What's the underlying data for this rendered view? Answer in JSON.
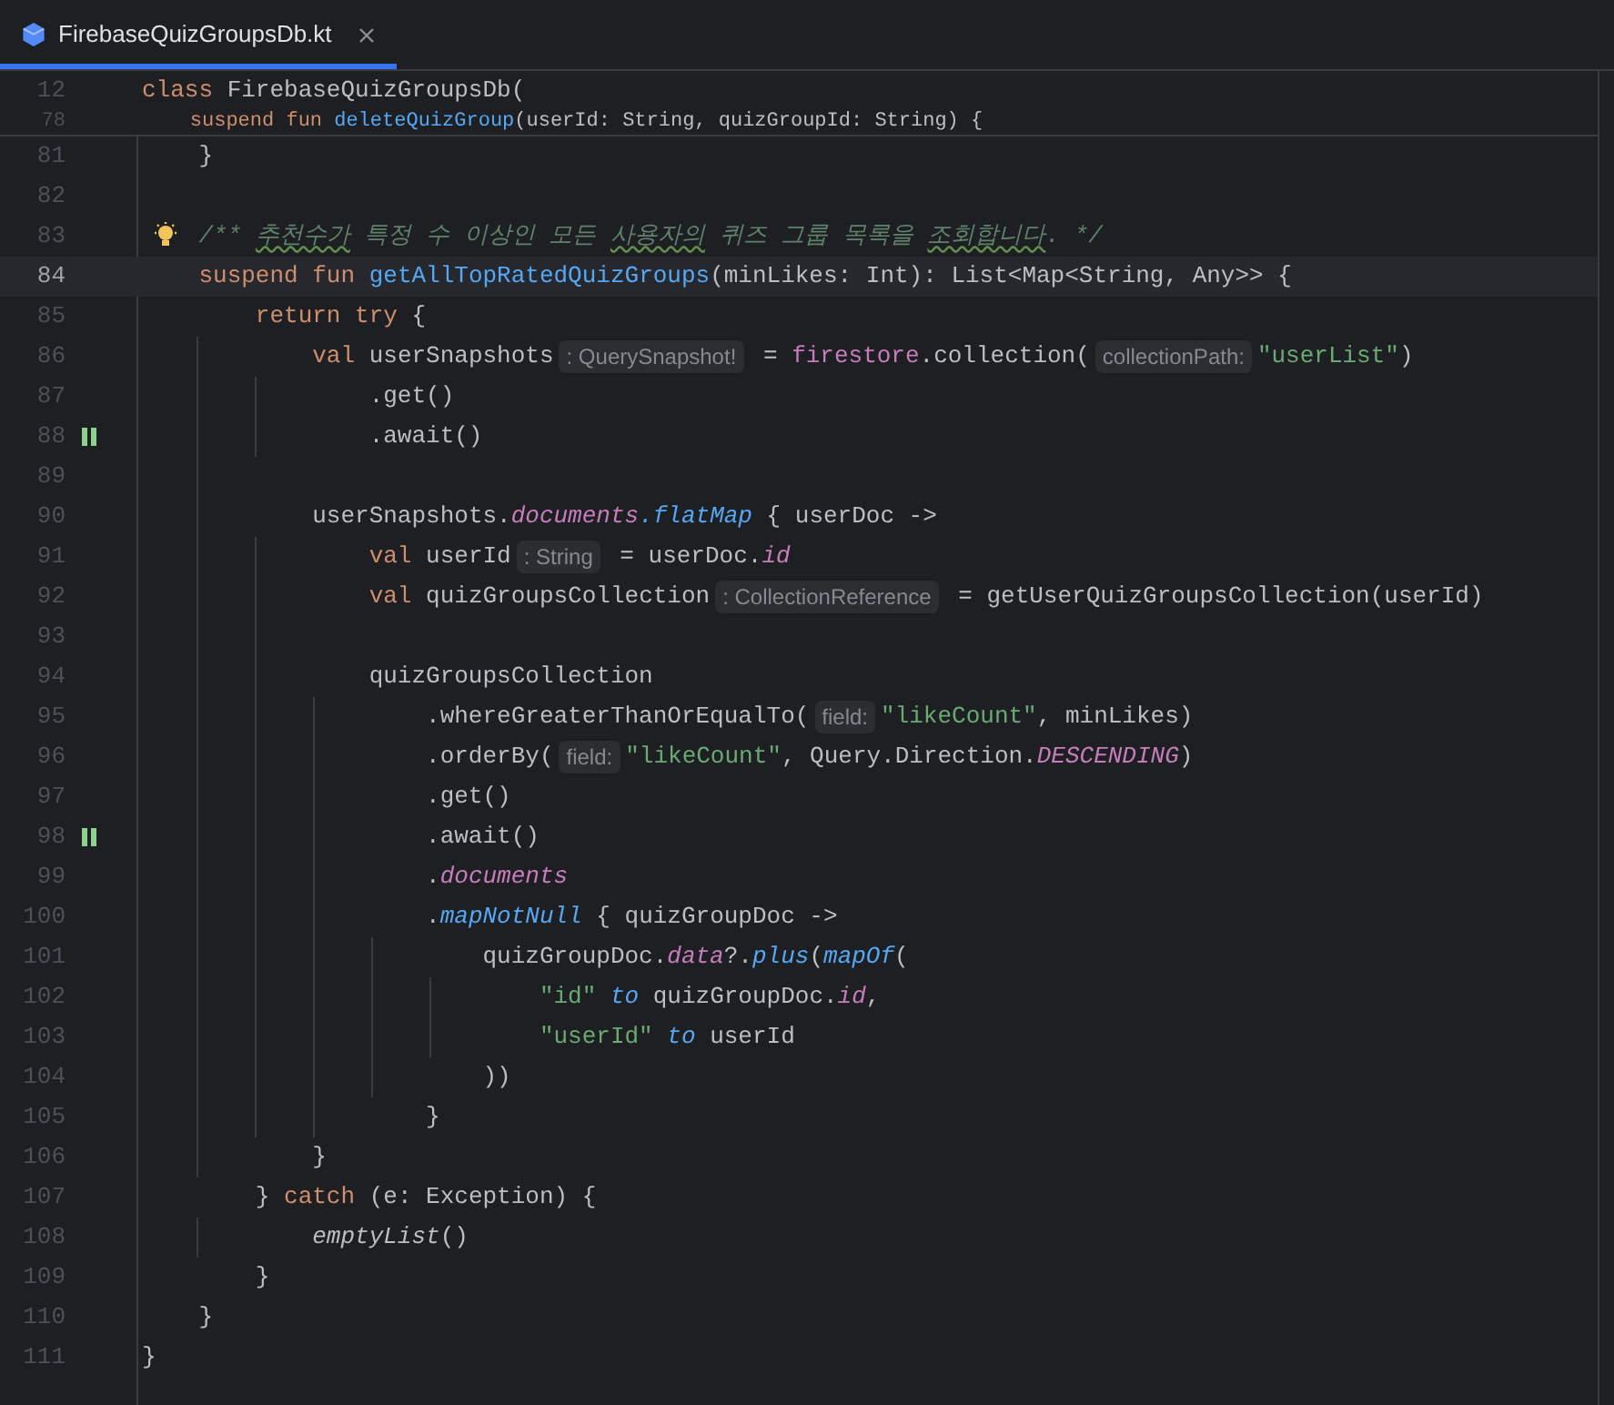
{
  "tab": {
    "title": "FirebaseQuizGroupsDb.kt",
    "selected": true
  },
  "sticky_lines": [
    {
      "number": "12",
      "tokens": [
        {
          "kind": "kw",
          "text": "class "
        },
        {
          "kind": "plain",
          "text": "FirebaseQuizGroupsDb("
        }
      ]
    },
    {
      "number": "78",
      "tokens": [
        {
          "kind": "kw",
          "text": "    suspend fun "
        },
        {
          "kind": "fn",
          "text": "deleteQuizGroup"
        },
        {
          "kind": "plain",
          "text": "(userId: String, quizGroupId: String) {"
        }
      ]
    }
  ],
  "lines": [
    {
      "number": "81",
      "current": false,
      "bulb": false,
      "suspend_call": false,
      "tokens": [
        {
          "kind": "plain",
          "text": "    }"
        }
      ]
    },
    {
      "number": "82",
      "current": false,
      "bulb": false,
      "suspend_call": false
    },
    {
      "number": "83",
      "current": false,
      "bulb": true,
      "suspend_call": false,
      "tokens": [
        {
          "kind": "doc",
          "text": "    /** "
        },
        {
          "kind": "typo",
          "text": "추천수가"
        },
        {
          "kind": "doc",
          "text": " 특정 수 이상인 모든 "
        },
        {
          "kind": "typo",
          "text": "사용자의"
        },
        {
          "kind": "doc",
          "text": " 퀴즈 그룹 목록을 "
        },
        {
          "kind": "typo",
          "text": "조회합니다"
        },
        {
          "kind": "doc",
          "text": ". */"
        }
      ]
    },
    {
      "number": "84",
      "current": true,
      "bulb": false,
      "suspend_call": false,
      "tokens": [
        {
          "kind": "kw",
          "text": "    suspend fun "
        },
        {
          "kind": "fn",
          "text": "getAllTopRatedQuizGroups"
        },
        {
          "kind": "plain",
          "text": "(minLikes: Int): List<Map<String, Any>> {"
        }
      ]
    },
    {
      "number": "85",
      "current": false,
      "bulb": false,
      "suspend_call": false,
      "tokens": [
        {
          "kind": "kw",
          "text": "        return try "
        },
        {
          "kind": "plain",
          "text": "{"
        }
      ]
    },
    {
      "number": "86",
      "current": false,
      "bulb": false,
      "suspend_call": false,
      "tokens": [
        {
          "kind": "kw",
          "text": "            val "
        },
        {
          "kind": "plain",
          "text": "userSnapshots"
        },
        {
          "kind": "hint",
          "text": ": QuerySnapshot!"
        },
        {
          "kind": "plain",
          "text": " = "
        },
        {
          "kind": "member",
          "text": "firestore"
        },
        {
          "kind": "plain",
          "text": ".collection("
        },
        {
          "kind": "hint",
          "text": "collectionPath:"
        },
        {
          "kind": "str",
          "text": "\"userList\""
        },
        {
          "kind": "plain",
          "text": ")"
        }
      ]
    },
    {
      "number": "87",
      "current": false,
      "bulb": false,
      "suspend_call": false,
      "tokens": [
        {
          "kind": "plain",
          "text": "                .get()"
        }
      ]
    },
    {
      "number": "88",
      "current": false,
      "bulb": false,
      "suspend_call": true,
      "tokens": [
        {
          "kind": "plain",
          "text": "                .await()"
        }
      ]
    },
    {
      "number": "89",
      "current": false,
      "bulb": false,
      "suspend_call": false
    },
    {
      "number": "90",
      "current": false,
      "bulb": false,
      "suspend_call": false,
      "tokens": [
        {
          "kind": "plain",
          "text": "            userSnapshots."
        },
        {
          "kind": "prop",
          "text": "documents"
        },
        {
          "kind": "ext",
          "text": ".flatMap"
        },
        {
          "kind": "plain",
          "text": " { userDoc ->"
        }
      ]
    },
    {
      "number": "91",
      "current": false,
      "bulb": false,
      "suspend_call": false,
      "tokens": [
        {
          "kind": "kw",
          "text": "                val "
        },
        {
          "kind": "plain",
          "text": "userId"
        },
        {
          "kind": "hint",
          "text": ": String"
        },
        {
          "kind": "plain",
          "text": " = userDoc."
        },
        {
          "kind": "prop",
          "text": "id"
        }
      ]
    },
    {
      "number": "92",
      "current": false,
      "bulb": false,
      "suspend_call": false,
      "tokens": [
        {
          "kind": "kw",
          "text": "                val "
        },
        {
          "kind": "plain",
          "text": "quizGroupsCollection"
        },
        {
          "kind": "hint",
          "text": ": CollectionReference"
        },
        {
          "kind": "plain",
          "text": " = getUserQuizGroupsCollection(userId)"
        }
      ]
    },
    {
      "number": "93",
      "current": false,
      "bulb": false,
      "suspend_call": false
    },
    {
      "number": "94",
      "current": false,
      "bulb": false,
      "suspend_call": false,
      "tokens": [
        {
          "kind": "plain",
          "text": "                quizGroupsCollection"
        }
      ]
    },
    {
      "number": "95",
      "current": false,
      "bulb": false,
      "suspend_call": false,
      "tokens": [
        {
          "kind": "plain",
          "text": "                    .whereGreaterThanOrEqualTo("
        },
        {
          "kind": "hint",
          "text": "field:"
        },
        {
          "kind": "str",
          "text": "\"likeCount\""
        },
        {
          "kind": "plain",
          "text": ", minLikes)"
        }
      ]
    },
    {
      "number": "96",
      "current": false,
      "bulb": false,
      "suspend_call": false,
      "tokens": [
        {
          "kind": "plain",
          "text": "                    .orderBy("
        },
        {
          "kind": "hint",
          "text": "field:"
        },
        {
          "kind": "str",
          "text": "\"likeCount\""
        },
        {
          "kind": "plain",
          "text": ", Query.Direction."
        },
        {
          "kind": "prop",
          "text": "DESCENDING"
        },
        {
          "kind": "plain",
          "text": ")"
        }
      ]
    },
    {
      "number": "97",
      "current": false,
      "bulb": false,
      "suspend_call": false,
      "tokens": [
        {
          "kind": "plain",
          "text": "                    .get()"
        }
      ]
    },
    {
      "number": "98",
      "current": false,
      "bulb": false,
      "suspend_call": true,
      "tokens": [
        {
          "kind": "plain",
          "text": "                    .await()"
        }
      ]
    },
    {
      "number": "99",
      "current": false,
      "bulb": false,
      "suspend_call": false,
      "tokens": [
        {
          "kind": "plain",
          "text": "                    ."
        },
        {
          "kind": "prop",
          "text": "documents"
        }
      ]
    },
    {
      "number": "100",
      "current": false,
      "bulb": false,
      "suspend_call": false,
      "tokens": [
        {
          "kind": "plain",
          "text": "                    ."
        },
        {
          "kind": "ext",
          "text": "mapNotNull"
        },
        {
          "kind": "plain",
          "text": " { quizGroupDoc ->"
        }
      ]
    },
    {
      "number": "101",
      "current": false,
      "bulb": false,
      "suspend_call": false,
      "tokens": [
        {
          "kind": "plain",
          "text": "                        quizGroupDoc."
        },
        {
          "kind": "prop",
          "text": "data"
        },
        {
          "kind": "plain",
          "text": "?."
        },
        {
          "kind": "ext",
          "text": "plus"
        },
        {
          "kind": "plain",
          "text": "("
        },
        {
          "kind": "ext",
          "text": "mapOf"
        },
        {
          "kind": "plain",
          "text": "("
        }
      ]
    },
    {
      "number": "102",
      "current": false,
      "bulb": false,
      "suspend_call": false,
      "tokens": [
        {
          "kind": "str",
          "text": "                            \"id\""
        },
        {
          "kind": "ext",
          "text": " to "
        },
        {
          "kind": "plain",
          "text": "quizGroupDoc."
        },
        {
          "kind": "prop",
          "text": "id"
        },
        {
          "kind": "plain",
          "text": ","
        }
      ]
    },
    {
      "number": "103",
      "current": false,
      "bulb": false,
      "suspend_call": false,
      "tokens": [
        {
          "kind": "str",
          "text": "                            \"userId\""
        },
        {
          "kind": "ext",
          "text": " to "
        },
        {
          "kind": "plain",
          "text": "userId"
        }
      ]
    },
    {
      "number": "104",
      "current": false,
      "bulb": false,
      "suspend_call": false,
      "tokens": [
        {
          "kind": "plain",
          "text": "                        ))"
        }
      ]
    },
    {
      "number": "105",
      "current": false,
      "bulb": false,
      "suspend_call": false,
      "tokens": [
        {
          "kind": "plain",
          "text": "                    }"
        }
      ]
    },
    {
      "number": "106",
      "current": false,
      "bulb": false,
      "suspend_call": false,
      "tokens": [
        {
          "kind": "plain",
          "text": "            }"
        }
      ]
    },
    {
      "number": "107",
      "current": false,
      "bulb": false,
      "suspend_call": false,
      "tokens": [
        {
          "kind": "plain",
          "text": "        } "
        },
        {
          "kind": "kw",
          "text": "catch "
        },
        {
          "kind": "plain",
          "text": "(e: Exception) {"
        }
      ]
    },
    {
      "number": "108",
      "current": false,
      "bulb": false,
      "suspend_call": false,
      "tokens": [
        {
          "kind": "ital",
          "text": "            emptyList"
        },
        {
          "kind": "plain",
          "text": "()"
        }
      ]
    },
    {
      "number": "109",
      "current": false,
      "bulb": false,
      "suspend_call": false,
      "tokens": [
        {
          "kind": "plain",
          "text": "        }"
        }
      ]
    },
    {
      "number": "110",
      "current": false,
      "bulb": false,
      "suspend_call": false,
      "tokens": [
        {
          "kind": "plain",
          "text": "    }"
        }
      ]
    },
    {
      "number": "111",
      "current": false,
      "bulb": false,
      "suspend_call": false,
      "tokens": [
        {
          "kind": "plain",
          "text": "}"
        }
      ]
    }
  ]
}
